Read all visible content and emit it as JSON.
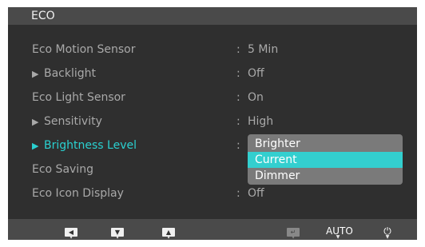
{
  "menu": {
    "title": "ECO",
    "items": [
      {
        "label": "Eco Motion Sensor",
        "value": "5 Min",
        "has_submenu": false
      },
      {
        "label": "Backlight",
        "value": "Off",
        "has_submenu": true
      },
      {
        "label": "Eco Light Sensor",
        "value": "On",
        "has_submenu": false
      },
      {
        "label": "Sensitivity",
        "value": "High",
        "has_submenu": true
      },
      {
        "label": "Brightness Level",
        "value": "",
        "has_submenu": true
      },
      {
        "label": "Eco Saving",
        "value": "",
        "has_submenu": false
      },
      {
        "label": "Eco Icon Display",
        "value": "Off",
        "has_submenu": false
      }
    ],
    "separator": ":",
    "submenu_arrow": "▶"
  },
  "dropdown": {
    "options": [
      "Brighter",
      "Current",
      "Dimmer"
    ],
    "selected": "Current"
  },
  "bottom_bar": {
    "left_icon": "◀",
    "down_icon": "▼",
    "up_icon": "▲",
    "enter_icon": "↵",
    "auto_label": "AUTO",
    "power_icon": "⏻",
    "dot": "▼"
  },
  "colors": {
    "accent": "#33cfcf",
    "background": "#2f2f2f",
    "title_bar": "#4a4a4a",
    "dropdown": "#7a7a7a"
  }
}
